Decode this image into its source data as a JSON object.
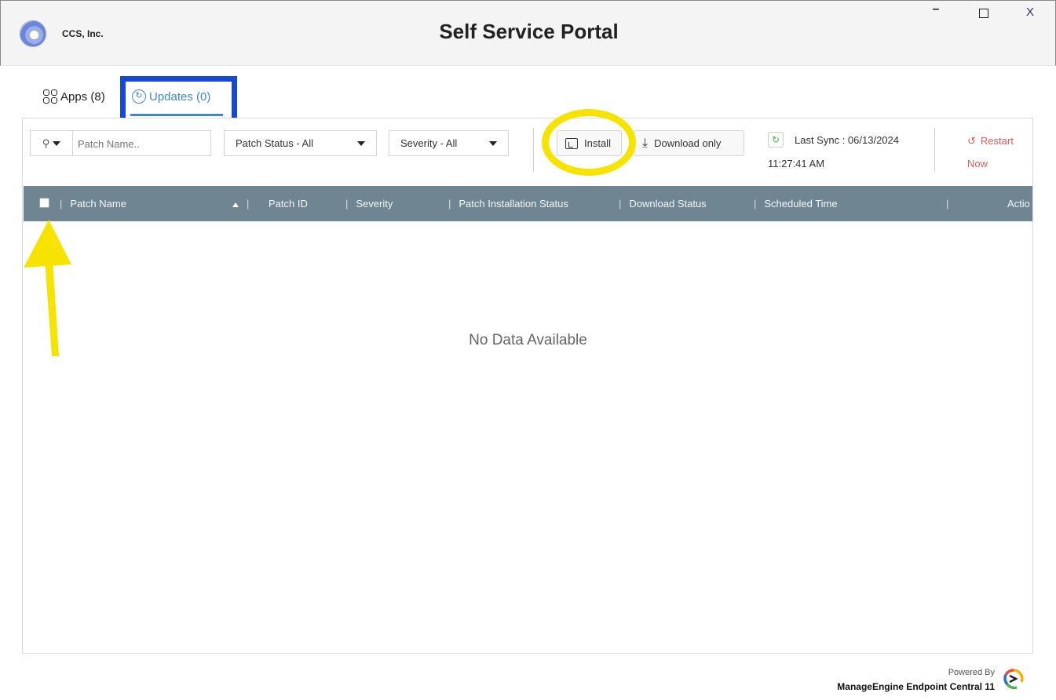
{
  "window": {
    "company": "CCS, Inc.",
    "title": "Self Service Portal",
    "minimize_label": "–",
    "close_label": "X"
  },
  "tabs": [
    {
      "label": "Apps (8)",
      "active": false
    },
    {
      "label": "Updates (0)",
      "active": true
    }
  ],
  "toolbar": {
    "search_placeholder": "Patch Name..",
    "patch_status_filter": "Patch Status - All",
    "severity_filter": "Severity - All",
    "install_label": "Install",
    "download_only_label": "Download only",
    "last_sync_label": "Last Sync : 06/13/2024",
    "last_sync_time": "11:27:41 AM",
    "restart_line1": "Restart",
    "restart_line2": "Now"
  },
  "table": {
    "columns": [
      "Patch Name",
      "Patch ID",
      "Severity",
      "Patch Installation Status",
      "Download Status",
      "Scheduled Time",
      "Actio"
    ],
    "empty_message": "No Data Available"
  },
  "footer": {
    "powered_by": "Powered By",
    "brand": "ManageEngine Endpoint Central 11"
  },
  "annotations": {
    "highlight_box_color": "#1448d6",
    "highlight_circle_color": "#f6e400",
    "arrow_color": "#f6e400"
  },
  "colors": {
    "accent": "#3d87d6",
    "table_header": "#6f8592",
    "restart": "#e45a5a"
  }
}
